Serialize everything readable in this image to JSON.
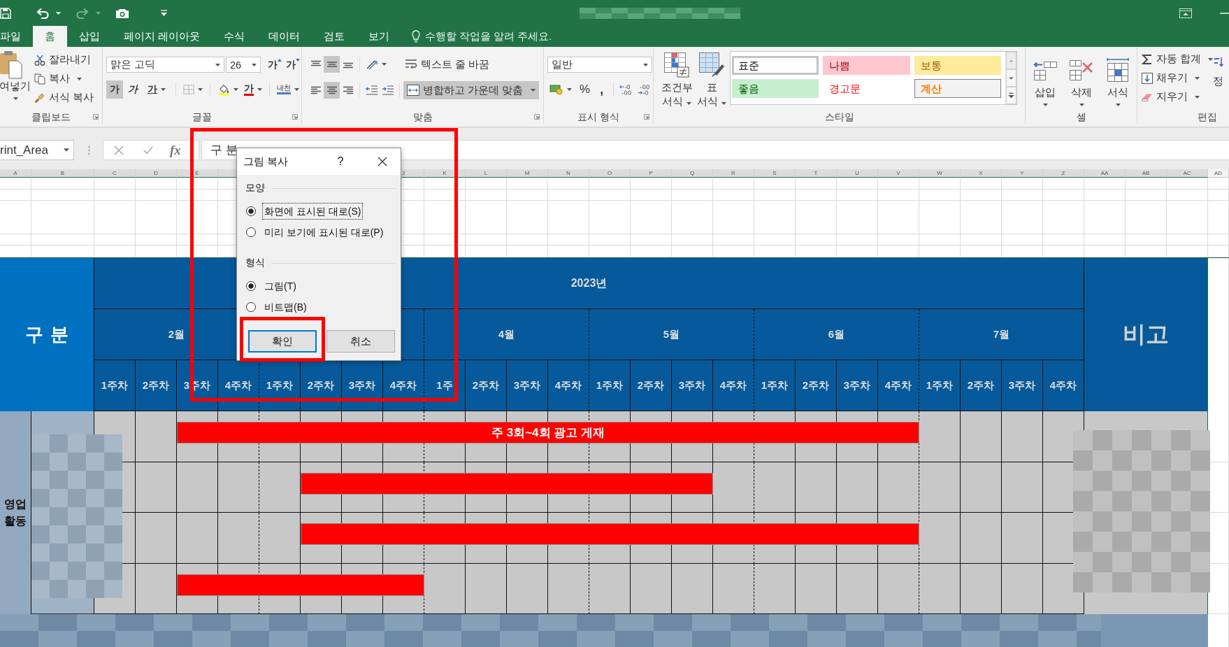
{
  "quick_access": [
    {
      "kind": "save",
      "disabled": false
    },
    {
      "kind": "undo",
      "disabled": false
    },
    {
      "kind": "redo",
      "disabled": true
    },
    {
      "kind": "camera",
      "disabled": false
    },
    {
      "kind": "customize",
      "disabled": false
    }
  ],
  "tabs": [
    {
      "label": "파일",
      "selected": false
    },
    {
      "label": "홈",
      "selected": true
    },
    {
      "label": "삽입",
      "selected": false
    },
    {
      "label": "페이지 레이아웃",
      "selected": false
    },
    {
      "label": "수식",
      "selected": false
    },
    {
      "label": "데이터",
      "selected": false
    },
    {
      "label": "검토",
      "selected": false
    },
    {
      "label": "보기",
      "selected": false
    }
  ],
  "tell_me": {
    "placeholder": "수행할 작업을 알려 주세요."
  },
  "ribbon": {
    "clipboard": {
      "title": "클립보드",
      "paste": "여넣기",
      "commands": [
        {
          "kind": "cut",
          "label": "잘라내기",
          "dropdown": false
        },
        {
          "kind": "copy",
          "label": "복사",
          "dropdown": true
        },
        {
          "kind": "format_painter",
          "label": "서식 복사",
          "dropdown": false
        }
      ]
    },
    "font": {
      "title": "글꼴",
      "font_name": "맑은 고딕",
      "font_size": "26",
      "grow": "가",
      "shrink": "가",
      "styles": [
        {
          "kind": "bold",
          "label": "가",
          "on": true
        },
        {
          "kind": "italic",
          "label": "가",
          "on": false
        },
        {
          "kind": "underline",
          "label": "가",
          "on": false
        }
      ],
      "font_color": "가",
      "phonetic": "내천"
    },
    "alignment": {
      "title": "맞춤",
      "vertical": [
        {
          "kind": "top",
          "on": false
        },
        {
          "kind": "middle",
          "on": true
        },
        {
          "kind": "bottom",
          "on": false
        }
      ],
      "horizontal": [
        {
          "kind": "left",
          "on": false
        },
        {
          "kind": "center",
          "on": true
        },
        {
          "kind": "right",
          "on": false
        }
      ],
      "wrap_text": {
        "label": "텍스트 줄 바꿈",
        "on": false
      },
      "merge": {
        "label": "병합하고 가운데 맞춤",
        "on": true
      }
    },
    "number": {
      "title": "표시 형식",
      "format": "일반",
      "percent": "%",
      "comma": ","
    },
    "styles": {
      "title": "스타일",
      "conditional": "조건부 서식",
      "table_format": "표 서식",
      "gallery": [
        {
          "label": "표준",
          "kind": "normal",
          "selected": true
        },
        {
          "label": "나쁨",
          "kind": "bad",
          "selected": false
        },
        {
          "label": "보통",
          "kind": "neutral",
          "selected": false
        },
        {
          "label": "좋음",
          "kind": "good",
          "selected": false
        },
        {
          "label": "경고문",
          "kind": "warning",
          "selected": false
        },
        {
          "label": "계산",
          "kind": "calculation",
          "selected": false
        }
      ]
    },
    "cells": {
      "title": "셀",
      "buttons": [
        {
          "kind": "insert",
          "label": "삽입"
        },
        {
          "kind": "delete",
          "label": "삭제"
        },
        {
          "kind": "format",
          "label": "서식"
        }
      ]
    },
    "editing": {
      "title": "편집",
      "commands": [
        {
          "kind": "autosum",
          "label": "자동 합계"
        },
        {
          "kind": "fill",
          "label": "채우기"
        },
        {
          "kind": "clear",
          "label": "지우기"
        }
      ],
      "sort": "정"
    }
  },
  "formula_bar": {
    "name_box": "rint_Area",
    "function_label": "fx",
    "formula": "구 분"
  },
  "column_headers": {
    "left": [
      {
        "label": "A",
        "selected": true
      },
      {
        "label": "B",
        "selected": true
      },
      {
        "label": "C",
        "selected": true
      },
      {
        "label": "D",
        "selected": true
      },
      {
        "label": "E",
        "selected": true
      }
    ],
    "right": [
      {
        "label": "J",
        "selected": true
      },
      {
        "label": "K",
        "selected": true
      },
      {
        "label": "L",
        "selected": true
      },
      {
        "label": "M",
        "selected": true
      },
      {
        "label": "N",
        "selected": true
      },
      {
        "label": "O",
        "selected": true
      },
      {
        "label": "P",
        "selected": true
      },
      {
        "label": "Q",
        "selected": true
      },
      {
        "label": "R",
        "selected": true
      },
      {
        "label": "S",
        "selected": true
      },
      {
        "label": "T",
        "selected": true
      },
      {
        "label": "U",
        "selected": true
      },
      {
        "label": "V",
        "selected": true
      },
      {
        "label": "W",
        "selected": true
      },
      {
        "label": "X",
        "selected": true
      },
      {
        "label": "Y",
        "selected": true
      },
      {
        "label": "Z",
        "selected": true
      },
      {
        "label": "AA",
        "selected": true
      },
      {
        "label": "AB",
        "selected": true
      },
      {
        "label": "AC",
        "selected": true
      },
      {
        "label": "AD",
        "selected": false
      }
    ]
  },
  "schedule": {
    "corner": "구 분",
    "year": "2023년",
    "months": [
      {
        "label": "2월",
        "weeks": [
          "1주차",
          "2주차",
          "3주차",
          "4주차"
        ]
      },
      {
        "weeks": [
          "1주차",
          "2주차",
          "3주차",
          "4주차"
        ]
      },
      {
        "label": "4월",
        "weeks": [
          "1주",
          "2주차",
          "3주차",
          "4주차"
        ]
      },
      {
        "label": "5월",
        "weeks": [
          "1주차",
          "2주차",
          "3주차",
          "4주차"
        ]
      },
      {
        "label": "6월",
        "weeks": [
          "1주차",
          "2주차",
          "3주차",
          "4주차"
        ]
      },
      {
        "label": "7월",
        "weeks": [
          "1주차",
          "2주차",
          "3주차",
          "4주차"
        ]
      }
    ],
    "remark": "비고",
    "group": "영업 활동",
    "rows": [
      {
        "scheduled": [
          false,
          false,
          true,
          true,
          true,
          true,
          true,
          true,
          true,
          true,
          true,
          true,
          true,
          true,
          true,
          true,
          true,
          true,
          true,
          true,
          false,
          false,
          false,
          false
        ],
        "bar_label": "주 3회~4회 광고 게재"
      },
      {
        "scheduled": [
          false,
          false,
          false,
          false,
          false,
          true,
          true,
          true,
          true,
          true,
          true,
          true,
          true,
          true,
          true,
          false,
          false,
          false,
          false,
          false,
          false,
          false,
          false,
          false
        ]
      },
      {
        "scheduled": [
          false,
          false,
          false,
          false,
          false,
          true,
          true,
          true,
          true,
          true,
          true,
          true,
          true,
          true,
          true,
          true,
          true,
          true,
          true,
          true,
          false,
          false,
          false,
          false
        ]
      },
      {
        "scheduled": [
          false,
          false,
          true,
          true,
          true,
          true,
          true,
          true,
          false,
          false,
          false,
          false,
          false,
          false,
          false,
          false,
          false,
          false,
          false,
          false,
          false,
          false,
          false,
          false
        ]
      }
    ]
  },
  "dialog": {
    "title": "그림 복사",
    "help": "?",
    "sections": [
      {
        "title": "모양",
        "options": [
          {
            "label": "화면에 표시된 대로(S)",
            "selected": true,
            "focused": true
          },
          {
            "label": "미리 보기에 표시된 대로(P)",
            "selected": false,
            "focused": false
          }
        ]
      },
      {
        "title": "형식",
        "options": [
          {
            "label": "그림(T)",
            "selected": true,
            "focused": false
          },
          {
            "label": "비트맵(B)",
            "selected": false,
            "focused": false
          }
        ]
      }
    ],
    "buttons": [
      {
        "label": "확인",
        "default": true
      },
      {
        "label": "취소",
        "default": false
      }
    ]
  }
}
